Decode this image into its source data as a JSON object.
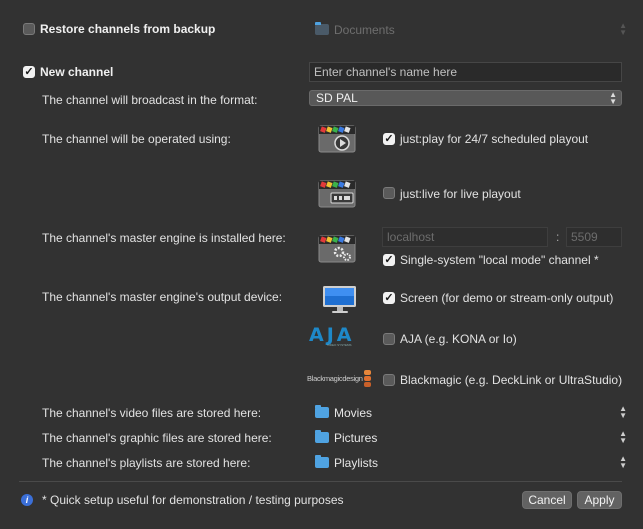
{
  "restore": {
    "checkbox_label": "Restore channels from backup",
    "checked": false,
    "folder_value": "Documents"
  },
  "new_channel": {
    "checkbox_label": "New channel",
    "checked": true,
    "name_placeholder": "Enter channel's name here"
  },
  "format": {
    "label": "The channel will broadcast in the format:",
    "value": "SD PAL"
  },
  "operation": {
    "label": "The channel will be operated using:",
    "justplay_label": "just:play for 24/7 scheduled playout",
    "justplay_checked": true,
    "justlive_label": "just:live for live playout",
    "justlive_checked": false
  },
  "engine": {
    "label": "The channel's master engine is installed here:",
    "host_placeholder": "localhost",
    "separator": ":",
    "port_placeholder": "5509",
    "local_mode_label": "Single-system \"local mode\" channel *",
    "local_mode_checked": true
  },
  "output": {
    "label": "The channel's master engine's output device:",
    "screen_label": "Screen (for demo or stream-only output)",
    "screen_checked": true,
    "aja_label": "AJA (e.g. KONA or Io)",
    "aja_checked": false,
    "aja_logo": "AJA",
    "aja_logo_sub": "VIDEO SYSTEMS",
    "bmd_label": "Blackmagic (e.g. DeckLink or UltraStudio)",
    "bmd_checked": false,
    "bmd_logo": "Blackmagicdesign"
  },
  "storage": {
    "video_label": "The channel's video files are stored here:",
    "video_value": "Movies",
    "graphic_label": "The channel's graphic files are stored here:",
    "graphic_value": "Pictures",
    "playlist_label": "The channel's playlists are stored here:",
    "playlist_value": "Playlists"
  },
  "footer": {
    "info_icon": "i",
    "note": "* Quick setup useful for demonstration / testing purposes",
    "cancel_label": "Cancel",
    "apply_label": "Apply"
  },
  "colors": {
    "background": "#323232",
    "folder_blue": "#4fa3e2",
    "info_blue": "#3b6fd8"
  }
}
